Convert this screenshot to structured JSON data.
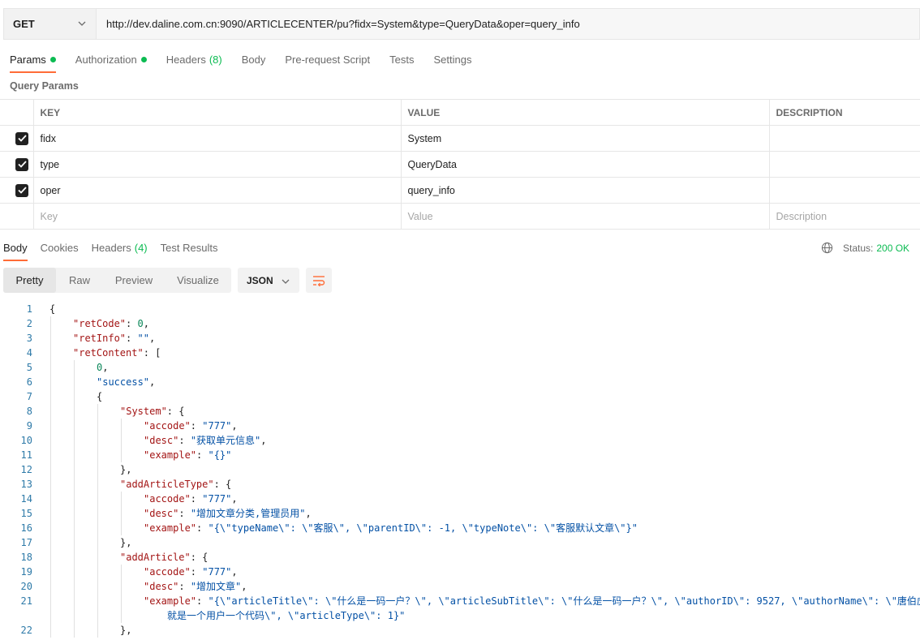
{
  "request": {
    "method": "GET",
    "url": "http://dev.daline.com.cn:9090/ARTICLECENTER/pu?fidx=System&type=QueryData&oper=query_info"
  },
  "request_tabs": {
    "params": "Params",
    "authorization": "Authorization",
    "headers": "Headers",
    "headers_count": "(8)",
    "body": "Body",
    "prerequest": "Pre-request Script",
    "tests": "Tests",
    "settings": "Settings"
  },
  "query_params": {
    "title": "Query Params",
    "columns": {
      "key": "KEY",
      "value": "VALUE",
      "description": "DESCRIPTION"
    },
    "rows": [
      {
        "key": "fidx",
        "value": "System",
        "description": ""
      },
      {
        "key": "type",
        "value": "QueryData",
        "description": ""
      },
      {
        "key": "oper",
        "value": "query_info",
        "description": ""
      }
    ],
    "placeholders": {
      "key": "Key",
      "value": "Value",
      "description": "Description"
    }
  },
  "response_tabs": {
    "body": "Body",
    "cookies": "Cookies",
    "headers": "Headers",
    "headers_count": "(4)",
    "test_results": "Test Results"
  },
  "status": {
    "label": "Status:",
    "value": "200 OK"
  },
  "view": {
    "pretty": "Pretty",
    "raw": "Raw",
    "preview": "Preview",
    "visualize": "Visualize",
    "format": "JSON"
  },
  "code_lines": [
    {
      "n": "1",
      "indent": 0,
      "parts": [
        [
          "p",
          "{"
        ]
      ]
    },
    {
      "n": "2",
      "indent": 1,
      "parts": [
        [
          "k",
          "\"retCode\""
        ],
        [
          "p",
          ": "
        ],
        [
          "n",
          "0"
        ],
        [
          "p",
          ","
        ]
      ]
    },
    {
      "n": "3",
      "indent": 1,
      "parts": [
        [
          "k",
          "\"retInfo\""
        ],
        [
          "p",
          ": "
        ],
        [
          "s",
          "\"\""
        ],
        [
          "p",
          ","
        ]
      ]
    },
    {
      "n": "4",
      "indent": 1,
      "parts": [
        [
          "k",
          "\"retContent\""
        ],
        [
          "p",
          ": ["
        ]
      ]
    },
    {
      "n": "5",
      "indent": 2,
      "parts": [
        [
          "n",
          "0"
        ],
        [
          "p",
          ","
        ]
      ]
    },
    {
      "n": "6",
      "indent": 2,
      "parts": [
        [
          "s",
          "\"success\""
        ],
        [
          "p",
          ","
        ]
      ]
    },
    {
      "n": "7",
      "indent": 2,
      "parts": [
        [
          "p",
          "{"
        ]
      ]
    },
    {
      "n": "8",
      "indent": 3,
      "parts": [
        [
          "k",
          "\"System\""
        ],
        [
          "p",
          ": {"
        ]
      ]
    },
    {
      "n": "9",
      "indent": 4,
      "parts": [
        [
          "k",
          "\"accode\""
        ],
        [
          "p",
          ": "
        ],
        [
          "s",
          "\"777\""
        ],
        [
          "p",
          ","
        ]
      ]
    },
    {
      "n": "10",
      "indent": 4,
      "parts": [
        [
          "k",
          "\"desc\""
        ],
        [
          "p",
          ": "
        ],
        [
          "s",
          "\"获取单元信息\""
        ],
        [
          "p",
          ","
        ]
      ]
    },
    {
      "n": "11",
      "indent": 4,
      "parts": [
        [
          "k",
          "\"example\""
        ],
        [
          "p",
          ": "
        ],
        [
          "s",
          "\"{}\""
        ]
      ]
    },
    {
      "n": "12",
      "indent": 3,
      "parts": [
        [
          "p",
          "},"
        ]
      ]
    },
    {
      "n": "13",
      "indent": 3,
      "parts": [
        [
          "k",
          "\"addArticleType\""
        ],
        [
          "p",
          ": {"
        ]
      ]
    },
    {
      "n": "14",
      "indent": 4,
      "parts": [
        [
          "k",
          "\"accode\""
        ],
        [
          "p",
          ": "
        ],
        [
          "s",
          "\"777\""
        ],
        [
          "p",
          ","
        ]
      ]
    },
    {
      "n": "15",
      "indent": 4,
      "parts": [
        [
          "k",
          "\"desc\""
        ],
        [
          "p",
          ": "
        ],
        [
          "s",
          "\"增加文章分类,管理员用\""
        ],
        [
          "p",
          ","
        ]
      ]
    },
    {
      "n": "16",
      "indent": 4,
      "parts": [
        [
          "k",
          "\"example\""
        ],
        [
          "p",
          ": "
        ],
        [
          "s",
          "\"{\\\"typeName\\\": \\\"客服\\\", \\\"parentID\\\": -1, \\\"typeNote\\\": \\\"客服默认文章\\\"}\""
        ]
      ]
    },
    {
      "n": "17",
      "indent": 3,
      "parts": [
        [
          "p",
          "},"
        ]
      ]
    },
    {
      "n": "18",
      "indent": 3,
      "parts": [
        [
          "k",
          "\"addArticle\""
        ],
        [
          "p",
          ": {"
        ]
      ]
    },
    {
      "n": "19",
      "indent": 4,
      "parts": [
        [
          "k",
          "\"accode\""
        ],
        [
          "p",
          ": "
        ],
        [
          "s",
          "\"777\""
        ],
        [
          "p",
          ","
        ]
      ]
    },
    {
      "n": "20",
      "indent": 4,
      "parts": [
        [
          "k",
          "\"desc\""
        ],
        [
          "p",
          ": "
        ],
        [
          "s",
          "\"增加文章\""
        ],
        [
          "p",
          ","
        ]
      ]
    },
    {
      "n": "21",
      "indent": 4,
      "parts": [
        [
          "k",
          "\"example\""
        ],
        [
          "p",
          ": "
        ],
        [
          "s",
          "\"{\\\"articleTitle\\\": \\\"什么是一码一户？\\\", \\\"articleSubTitle\\\": \\\"什么是一码一户？\\\", \\\"authorID\\\": 9527, \\\"authorName\\\": \\\"唐伯虎"
        ]
      ]
    },
    {
      "n": "",
      "indent": 5,
      "parts": [
        [
          "s",
          "就是一个用户一个代码\\\", \\\"articleType\\\": 1}\""
        ]
      ]
    },
    {
      "n": "22",
      "indent": 3,
      "parts": [
        [
          "p",
          "},"
        ]
      ]
    }
  ]
}
